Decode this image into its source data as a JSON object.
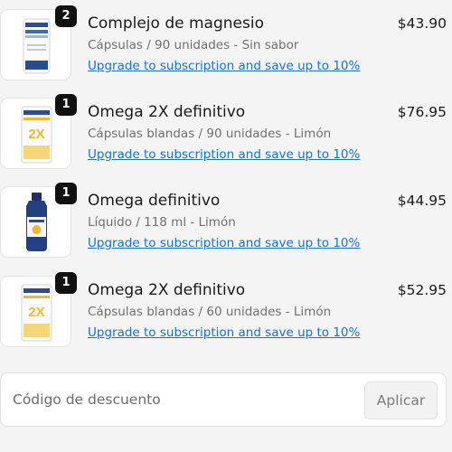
{
  "items": [
    {
      "quantity": "2",
      "name": "Complejo de magnesio",
      "variant": "Cápsulas / 90 unidades - Sin sabor",
      "upgrade_link": "Upgrade to subscription and save up to 10%",
      "price": "$43.90",
      "image_icon": "magnesium-bottle-icon",
      "image_label": "MAGNESIUM"
    },
    {
      "quantity": "1",
      "name": "Omega 2X definitivo",
      "variant": "Cápsulas blandas / 90 unidades - Limón",
      "upgrade_link": "Upgrade to subscription and save up to 10%",
      "price": "$76.95",
      "image_icon": "omega-2x-box-icon",
      "image_label": "2X"
    },
    {
      "quantity": "1",
      "name": "Omega definitivo",
      "variant": "Líquido / 118 ml - Limón",
      "upgrade_link": "Upgrade to subscription and save up to 10%",
      "price": "$44.95",
      "image_icon": "omega-liquid-bottle-icon"
    },
    {
      "quantity": "1",
      "name": "Omega 2X definitivo",
      "variant": "Cápsulas blandas / 60 unidades - Limón",
      "upgrade_link": "Upgrade to subscription and save up to 10%",
      "price": "$52.95",
      "image_icon": "omega-2x-box-icon",
      "image_label": "2X"
    }
  ],
  "discount": {
    "placeholder": "Código de descuento",
    "apply_label": "Aplicar"
  },
  "colors": {
    "link": "#1773d1",
    "badge": "#111111",
    "brand_blue": "#2a4d8f",
    "brand_yellow": "#f2b632"
  }
}
